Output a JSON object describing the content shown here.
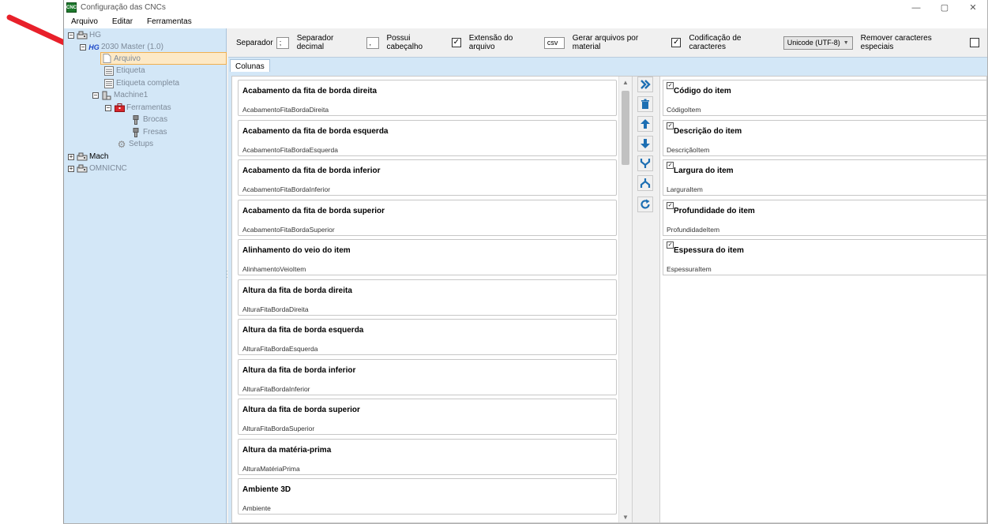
{
  "window": {
    "title": "Configuração das CNCs",
    "logo_text": "CNC",
    "controls": [
      "—",
      "▢",
      "✕"
    ]
  },
  "menu": [
    "Arquivo",
    "Editar",
    "Ferramentas"
  ],
  "tree": {
    "hg": "HG",
    "master": "2030 Master (1.0)",
    "master_logo": "HG",
    "arquivo": "Arquivo",
    "etiqueta": "Etiqueta",
    "etiqueta_completa": "Etiqueta completa",
    "machine1": "Machine1",
    "ferramentas": "Ferramentas",
    "brocas": "Brocas",
    "fresas": "Fresas",
    "setups": "Setups",
    "mach": "Mach",
    "omnicnc": "OMNICNC"
  },
  "options": {
    "separador_label": "Separador",
    "separador_value": ";",
    "separador_decimal_label": "Separador decimal",
    "separador_decimal_value": ",",
    "possui_cabecalho_label": "Possui cabeçalho",
    "possui_cabecalho_checked": "✓",
    "extensao_label": "Extensão do arquivo",
    "extensao_value": "csv",
    "gerar_arquivos_label": "Gerar arquivos por material",
    "gerar_arquivos_checked": "✓",
    "codificacao_label": "Codificação de caracteres",
    "codificacao_value": "Unicode (UTF-8)",
    "remover_label": "Remover caracteres especiais"
  },
  "tab": {
    "label": "Colunas"
  },
  "available_columns": [
    {
      "title": "Acabamento da fita de borda direita",
      "field": "AcabamentoFitaBordaDireita"
    },
    {
      "title": "Acabamento da fita de borda esquerda",
      "field": "AcabamentoFitaBordaEsquerda"
    },
    {
      "title": "Acabamento da fita de borda inferior",
      "field": "AcabamentoFitaBordaInferior"
    },
    {
      "title": "Acabamento da fita de borda superior",
      "field": "AcabamentoFitaBordaSuperior"
    },
    {
      "title": "Alinhamento do veio do item",
      "field": "AlinhamentoVeioItem"
    },
    {
      "title": "Altura da fita de borda direita",
      "field": "AlturaFitaBordaDireita"
    },
    {
      "title": "Altura da fita de borda esquerda",
      "field": "AlturaFitaBordaEsquerda"
    },
    {
      "title": "Altura da fita de borda inferior",
      "field": "AlturaFitaBordaInferior"
    },
    {
      "title": "Altura da fita de borda superior",
      "field": "AlturaFitaBordaSuperior"
    },
    {
      "title": "Altura da matéria-prima",
      "field": "AlturaMatériaPrima"
    },
    {
      "title": "Ambiente 3D",
      "field": "Ambiente"
    }
  ],
  "selected_columns": [
    {
      "title": "Código do item",
      "field": "CódigoItem",
      "check": "✓"
    },
    {
      "title": "Descrição do item",
      "field": "DescriçãoItem",
      "check": "✓"
    },
    {
      "title": "Largura do item",
      "field": "LarguraItem",
      "check": "✓"
    },
    {
      "title": "Profundidade do item",
      "field": "ProfundidadeItem",
      "check": "✓"
    },
    {
      "title": "Espessura do item",
      "field": "EspessuraItem",
      "check": "✓"
    }
  ],
  "colors": {
    "panel_blue": "#d3e7f7",
    "selection_orange": "#fde9c6",
    "action_blue": "#1d6fb3",
    "annotation_red": "#e8202a"
  }
}
